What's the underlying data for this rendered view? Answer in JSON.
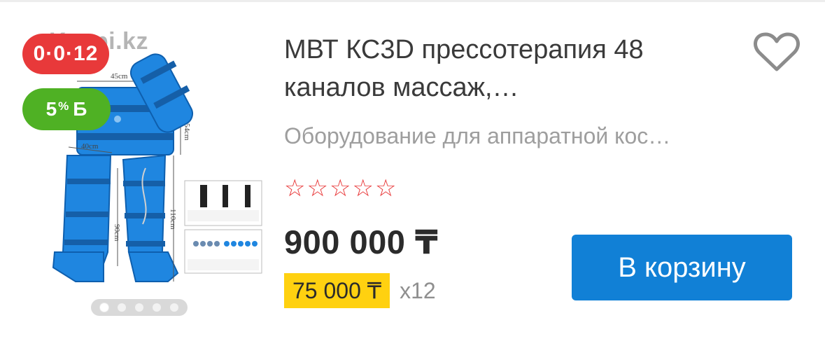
{
  "product": {
    "image_watermark": "Kaspi.kz",
    "timer_badge": "0·0·12",
    "bonus_badge": {
      "value": "5",
      "unit": "%",
      "symbol": "Б"
    },
    "image_labels": [
      "45cm",
      "54cm",
      "40cm",
      "90cm",
      "110cm"
    ],
    "carousel": {
      "count": 5,
      "active_index": 0
    },
    "title": "МВТ КС3D прессотерапия 48 каналов массаж,…",
    "category": "Оборудование для аппаратной кос…",
    "rating": {
      "stars_filled": 0,
      "stars_total": 5
    },
    "price": "900 000 ₸",
    "monthly_payment": "75 000 ₸",
    "installment_months": "x12",
    "add_to_cart_label": "В корзину"
  },
  "icons": {
    "favorite": "heart-outline-icon",
    "star": "star-outline-icon"
  },
  "colors": {
    "accent_blue": "#1180d6",
    "timer_red": "#e8393a",
    "bonus_green": "#4fb124",
    "installment_yellow": "#ffd110",
    "product_blue": "#1f86e0"
  }
}
